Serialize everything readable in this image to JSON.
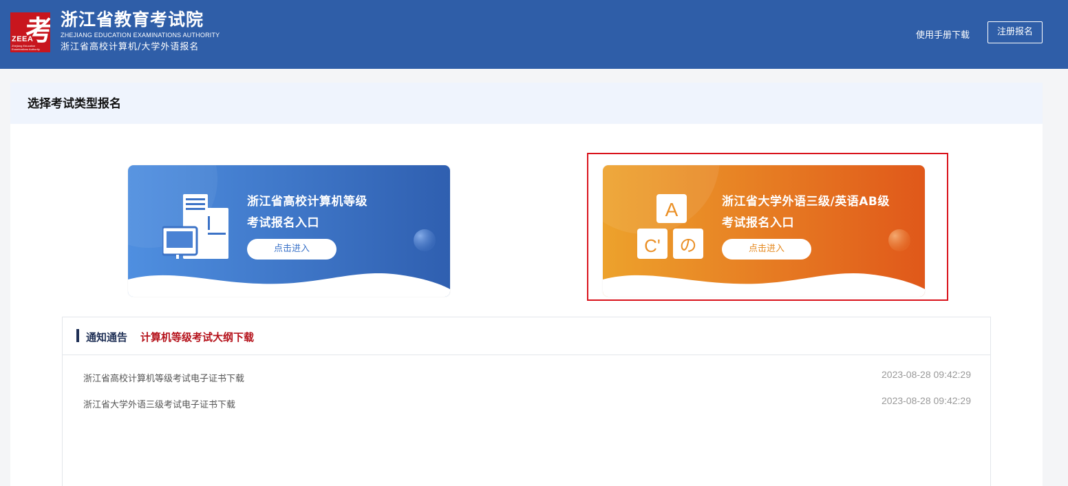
{
  "header": {
    "logo_glyph": "考",
    "logo_abbr": "ZEEA",
    "logo_tiny": "Zhejiang Education Examinations Authority",
    "title": "浙江省教育考试院",
    "title_en": "ZHEJIANG EDUCATION EXAMINATIONS AUTHORITY",
    "subtitle": "浙江省高校计算机/大学外语报名",
    "manual_link": "使用手册下载",
    "register_button": "注册报名"
  },
  "main": {
    "section_title": "选择考试类型报名",
    "cards": [
      {
        "line1": "浙江省高校计算机等级",
        "line2": "考试报名入口",
        "button": "点击进入",
        "icon": "computer-icon",
        "color_from": "#4f8fe0",
        "color_to": "#2f5fb0"
      },
      {
        "line1": "浙江省大学外语三级/英语AB级",
        "line2": "考试报名入口",
        "button": "点击进入",
        "icon": "language-blocks-icon",
        "icon_letters": [
          "A",
          "C'",
          "の"
        ],
        "color_from": "#eda22c",
        "color_to": "#e0581a",
        "highlighted": true
      }
    ]
  },
  "notice": {
    "title": "通知通告",
    "link": "计算机等级考试大纲下载",
    "items": [
      {
        "text": "浙江省高校计算机等级考试电子证书下载",
        "date": "2023-08-28 09:42:29"
      },
      {
        "text": "浙江省大学外语三级考试电子证书下载",
        "date": "2023-08-28 09:42:29"
      }
    ]
  },
  "colors": {
    "header_bg": "#2f5ea8",
    "panel_head_bg": "#eff4fd",
    "highlight": "#d9121b",
    "notice_link": "#b5121b"
  }
}
